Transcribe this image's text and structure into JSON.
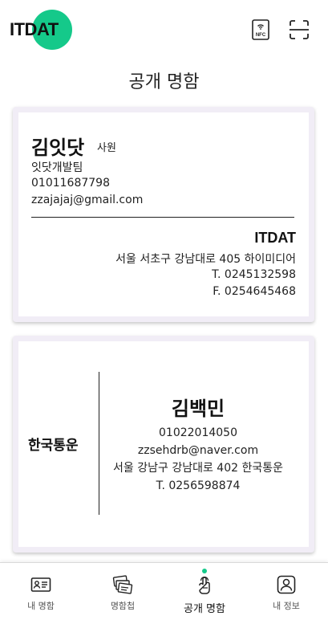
{
  "header": {
    "logo_text": "ITDAT",
    "nfc_label": "NFC",
    "nfc_icon": "nfc-icon",
    "scan_icon": "scan-icon"
  },
  "page_title": "공개 명함",
  "cards": [
    {
      "name": "김잇닷",
      "rank": "사원",
      "department": "잇닷개발팀",
      "phone": "01011687798",
      "email": "zzajajaj@gmail.com",
      "company": "ITDAT",
      "address": "서울 서초구 강남대로 405 하이미디어",
      "tel": "T. 0245132598",
      "fax": "F. 0254645468"
    },
    {
      "company": "한국통운",
      "name": "김백민",
      "phone": "01022014050",
      "email": "zzsehdrb@naver.com",
      "address": "서울 강남구 강남대로 402 한국통운",
      "tel": "T. 0256598874"
    }
  ],
  "bottom_nav": [
    {
      "label": "내 명함",
      "icon": "id-card-icon",
      "active": false
    },
    {
      "label": "명함첩",
      "icon": "card-stack-icon",
      "active": false
    },
    {
      "label": "공개 명함",
      "icon": "touch-hand-icon",
      "active": true
    },
    {
      "label": "내 정보",
      "icon": "user-profile-icon",
      "active": false
    }
  ],
  "colors": {
    "accent": "#15c98a",
    "card_border": "#f1edf6",
    "text": "#1b1b1b"
  }
}
